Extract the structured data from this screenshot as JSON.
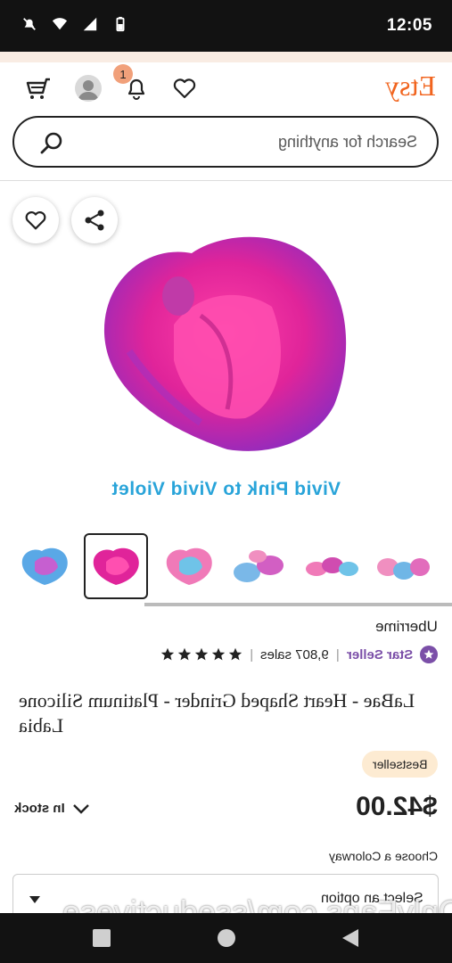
{
  "status_bar": {
    "time": "12:05"
  },
  "header": {
    "logo": "Etsy",
    "notifications_count": "1"
  },
  "search": {
    "placeholder": "Search for anything"
  },
  "product": {
    "image_caption": "Vivid Pink to Vivid Violet",
    "shop_name": "Uberrime",
    "star_seller_label": "Star Seller",
    "sales": "9,807 sales",
    "rating": 5,
    "title": "LaBae - Heart Shaped Grinder - Platinum Silicone Labia",
    "badge": "Bestseller",
    "price": "$42.00",
    "stock": "In stock",
    "variation_label": "Choose a Colorway",
    "variation_select": "Select an option"
  },
  "thumbnails": [
    {
      "selected": false
    },
    {
      "selected": true
    },
    {
      "selected": false
    },
    {
      "selected": false
    },
    {
      "selected": false
    },
    {
      "selected": false
    }
  ],
  "watermark": "OnlyFans.com/sseductivese",
  "colors": {
    "brand": "#F1641E",
    "star_seller": "#7b4fa8",
    "caption": "#29a4d9",
    "bestseller_bg": "#FDEBD2"
  },
  "icons": [
    "cart-icon",
    "avatar-icon",
    "bell-icon",
    "heart-icon",
    "search-icon",
    "share-icon",
    "star-icon",
    "check-chevron-icon"
  ]
}
